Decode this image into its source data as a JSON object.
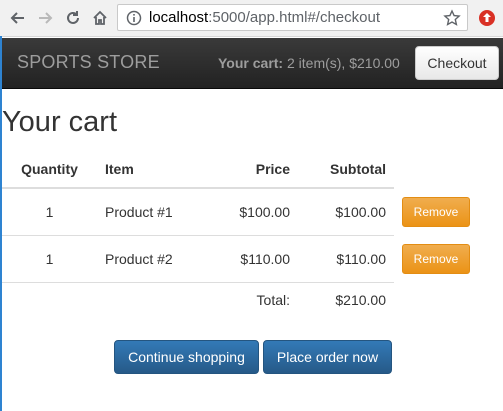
{
  "browser": {
    "url_host": "localhost",
    "url_rest": ":5000/app.html#/checkout",
    "icons": [
      "back-arrow-icon",
      "forward-arrow-icon",
      "reload-icon",
      "home-icon",
      "info-icon",
      "star-icon",
      "extension-icon"
    ]
  },
  "navbar": {
    "brand": "SPORTS STORE",
    "cart_label": "Your cart:",
    "cart_summary": "2 item(s), $210.00",
    "checkout_label": "Checkout"
  },
  "page": {
    "title": "Your cart"
  },
  "table": {
    "headers": {
      "quantity": "Quantity",
      "item": "Item",
      "price": "Price",
      "subtotal": "Subtotal"
    },
    "rows": [
      {
        "quantity": "1",
        "item": "Product #1",
        "price": "$100.00",
        "subtotal": "$100.00",
        "action": "Remove"
      },
      {
        "quantity": "1",
        "item": "Product #2",
        "price": "$110.00",
        "subtotal": "$110.00",
        "action": "Remove"
      }
    ],
    "total_label": "Total:",
    "total_value": "$210.00"
  },
  "actions": {
    "continue": "Continue shopping",
    "place_order": "Place order now"
  },
  "colors": {
    "navbar": "#222222",
    "primary": "#337ab7",
    "warning": "#f0ad4e"
  }
}
